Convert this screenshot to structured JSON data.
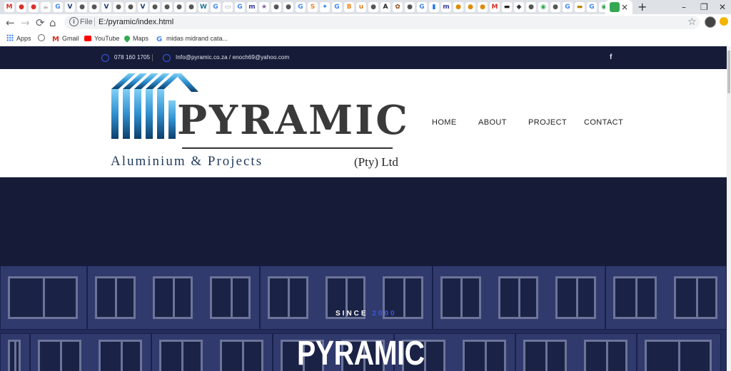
{
  "browser": {
    "tab_favicons": [
      {
        "glyph": "M",
        "color": "#d93025"
      },
      {
        "glyph": "●",
        "color": "#d93025"
      },
      {
        "glyph": "●",
        "color": "#d93025"
      },
      {
        "glyph": "☕",
        "color": "#777777"
      },
      {
        "glyph": "G",
        "color": "#4285f4"
      },
      {
        "glyph": "V",
        "color": "#1a3a6b"
      },
      {
        "glyph": "●",
        "color": "#555555"
      },
      {
        "glyph": "●",
        "color": "#555555"
      },
      {
        "glyph": "V",
        "color": "#1a3a6b"
      },
      {
        "glyph": "●",
        "color": "#555555"
      },
      {
        "glyph": "●",
        "color": "#555555"
      },
      {
        "glyph": "V",
        "color": "#1a3a6b"
      },
      {
        "glyph": "●",
        "color": "#555555"
      },
      {
        "glyph": "●",
        "color": "#555555"
      },
      {
        "glyph": "●",
        "color": "#555555"
      },
      {
        "glyph": "●",
        "color": "#555555"
      },
      {
        "glyph": "W",
        "color": "#21759b"
      },
      {
        "glyph": "G",
        "color": "#4285f4"
      },
      {
        "glyph": "▭",
        "color": "#999999"
      },
      {
        "glyph": "G",
        "color": "#4285f4"
      },
      {
        "glyph": "m",
        "color": "#3b3b9e"
      },
      {
        "glyph": "★",
        "color": "#7b5ea7"
      },
      {
        "glyph": "●",
        "color": "#555555"
      },
      {
        "glyph": "●",
        "color": "#555555"
      },
      {
        "glyph": "G",
        "color": "#4285f4"
      },
      {
        "glyph": "S",
        "color": "#f4801f"
      },
      {
        "glyph": "✦",
        "color": "#1e88e5"
      },
      {
        "glyph": "G",
        "color": "#4285f4"
      },
      {
        "glyph": "B",
        "color": "#f4801f"
      },
      {
        "glyph": "u",
        "color": "#e67e22"
      },
      {
        "glyph": "●",
        "color": "#555555"
      },
      {
        "glyph": "A",
        "color": "#222222"
      },
      {
        "glyph": "✿",
        "color": "#8b4513"
      },
      {
        "glyph": "●",
        "color": "#555555"
      },
      {
        "glyph": "G",
        "color": "#4285f4"
      },
      {
        "glyph": "▮",
        "color": "#1a73e8"
      },
      {
        "glyph": "m",
        "color": "#3b3b9e"
      },
      {
        "glyph": "●",
        "color": "#e08a00"
      },
      {
        "glyph": "●",
        "color": "#e08a00"
      },
      {
        "glyph": "●",
        "color": "#e08a00"
      },
      {
        "glyph": "M",
        "color": "#d93025"
      },
      {
        "glyph": "▬",
        "color": "#222222"
      },
      {
        "glyph": "◆",
        "color": "#333333"
      },
      {
        "glyph": "●",
        "color": "#555555"
      },
      {
        "glyph": "◉",
        "color": "#34a853"
      },
      {
        "glyph": "●",
        "color": "#555555"
      },
      {
        "glyph": "G",
        "color": "#4285f4"
      },
      {
        "glyph": "▬",
        "color": "#b8860b"
      },
      {
        "glyph": "G",
        "color": "#4285f4"
      },
      {
        "glyph": "◉",
        "color": "#34a853"
      }
    ],
    "tab_close": "×",
    "new_tab": "+",
    "window_controls": [
      "–",
      "❐",
      "✕"
    ],
    "nav": {
      "back": "←",
      "forward": "→",
      "reload": "⟳",
      "home": "⌂"
    },
    "address": {
      "scheme_label": "File",
      "url": "E:/pyramic/index.html"
    },
    "star": "☆",
    "bookmarks": [
      {
        "label": "Apps",
        "icon": "apps-icon",
        "color": "#4285f4"
      },
      {
        "label": "",
        "icon": "globe-icon",
        "color": "#5f6368"
      },
      {
        "label": "Gmail",
        "icon": "gmail-icon",
        "color": "#d93025"
      },
      {
        "label": "YouTube",
        "icon": "youtube-icon",
        "color": "#ff0000"
      },
      {
        "label": "Maps",
        "icon": "maps-icon",
        "color": "#34a853"
      },
      {
        "label": "midas midrand cata...",
        "icon": "google-icon",
        "color": "#4285f4"
      }
    ]
  },
  "site": {
    "topbar": {
      "phone": "078 160 1705",
      "email": "Info@pyramic.co.za / enoch69@yahoo.com",
      "facebook": "f"
    },
    "logo": {
      "wordmark": "PYRAMIC",
      "subtitle": "Aluminium & Projects",
      "suffix": "(Pty) Ltd"
    },
    "nav": [
      "HOME",
      "ABOUT",
      "PROJECT",
      "CONTACT"
    ],
    "hero": {
      "since_label": "SINCE",
      "since_year": "2000",
      "title": "PYRAMIC"
    },
    "colors": {
      "navy": "#161c38",
      "accent": "#3b57e0",
      "logo_blue": "#3a9bd9"
    }
  }
}
